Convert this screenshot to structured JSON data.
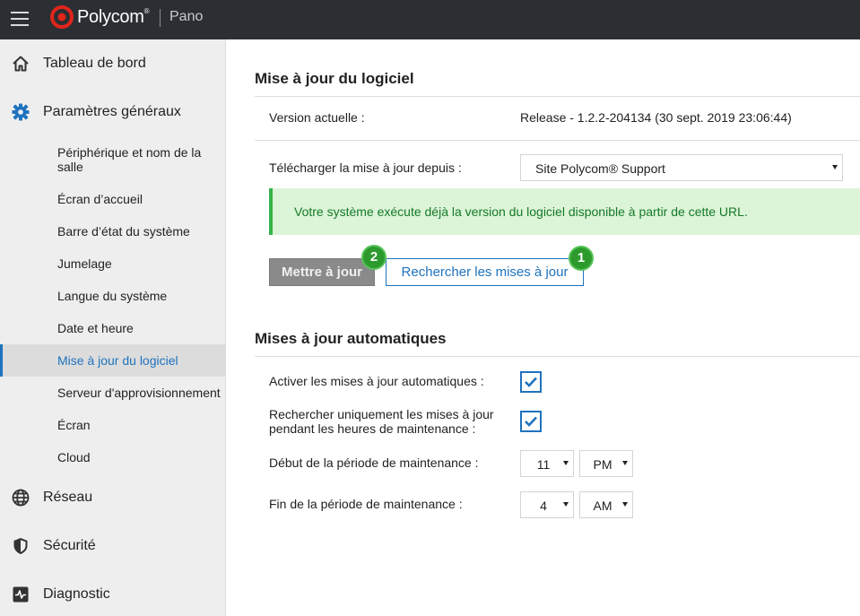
{
  "header": {
    "brand": "Polycom",
    "brand_mark": "®",
    "product": "Pano",
    "icons": {
      "menu": "hamburger-menu-icon",
      "logo": "polycom-logo-icon"
    }
  },
  "sidebar": {
    "items": [
      {
        "label": "Tableau de bord",
        "icon": "home-icon",
        "level": 1
      },
      {
        "label": "Paramètres généraux",
        "icon": "gear-icon",
        "level": 1
      },
      {
        "label": "Périphérique et nom de la salle",
        "level": 2
      },
      {
        "label": "Écran d’accueil",
        "level": 2
      },
      {
        "label": "Barre d’état du système",
        "level": 2
      },
      {
        "label": "Jumelage",
        "level": 2
      },
      {
        "label": "Langue du système",
        "level": 2
      },
      {
        "label": "Date et heure",
        "level": 2
      },
      {
        "label": "Mise à jour du logiciel",
        "level": 2,
        "active": true
      },
      {
        "label": "Serveur d'approvisionnement",
        "level": 2
      },
      {
        "label": "Écran",
        "level": 2
      },
      {
        "label": "Cloud",
        "level": 2
      },
      {
        "label": "Réseau",
        "icon": "globe-icon",
        "level": 1
      },
      {
        "label": "Sécurité",
        "icon": "shield-icon",
        "level": 1
      },
      {
        "label": "Diagnostic",
        "icon": "pulse-icon",
        "level": 1
      }
    ]
  },
  "software_update": {
    "title": "Mise à jour du logiciel",
    "current_version_label": "Version actuelle :",
    "current_version_value": "Release - 1.2.2-204134 (30 sept. 2019 23:06:44)",
    "download_from_label": "Télécharger la mise à jour depuis :",
    "download_from_value": "Site Polycom® Support",
    "alert_text": "Votre système exécute déjà la version du logiciel disponible à partir de cette URL.",
    "update_button": "Mettre à jour",
    "check_button": "Rechercher les mises à jour",
    "marker_update": "2",
    "marker_check": "1"
  },
  "auto_updates": {
    "title": "Mises à jour automatiques",
    "enable_label": "Activer les mises à jour automatiques :",
    "enable_checked": true,
    "maintenance_only_label_line1": "Rechercher uniquement les mises à jour",
    "maintenance_only_label_line2": "pendant les heures de maintenance :",
    "maintenance_only_checked": true,
    "start_label": "Début de la période de maintenance :",
    "start_hour": "11",
    "start_ampm": "PM",
    "end_label": "Fin de la période de maintenance :",
    "end_hour": "4",
    "end_ampm": "AM"
  },
  "colors": {
    "topbar": "#2b2f33",
    "accent": "#1e73be",
    "success_bg": "#dcf4d7",
    "success_border": "#35b34a",
    "success_text": "#157a2a",
    "marker": "#2c9a2c"
  }
}
